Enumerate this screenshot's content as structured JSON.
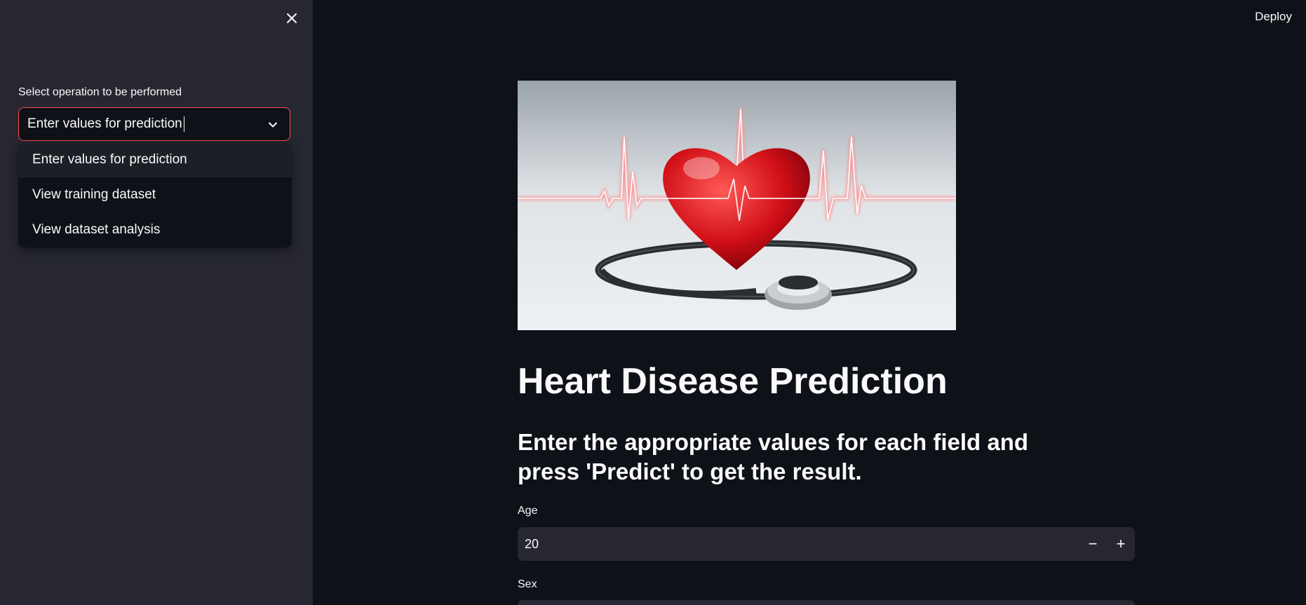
{
  "header": {
    "deploy_label": "Deploy"
  },
  "sidebar": {
    "select_label": "Select operation to be performed",
    "select_value": "Enter values for prediction",
    "options": [
      {
        "label": "Enter values for prediction"
      },
      {
        "label": "View training dataset"
      },
      {
        "label": "View dataset analysis"
      }
    ],
    "accent_color": "#ff4b4b"
  },
  "main": {
    "hero_image": "heart-with-stethoscope-image",
    "title": "Heart Disease Prediction",
    "subtitle": "Enter the appropriate values for each field and press 'Predict' to get the result.",
    "fields": {
      "age_label": "Age",
      "age_value": "20",
      "decrement_symbol": "−",
      "increment_symbol": "+",
      "sex_label": "Sex"
    }
  }
}
